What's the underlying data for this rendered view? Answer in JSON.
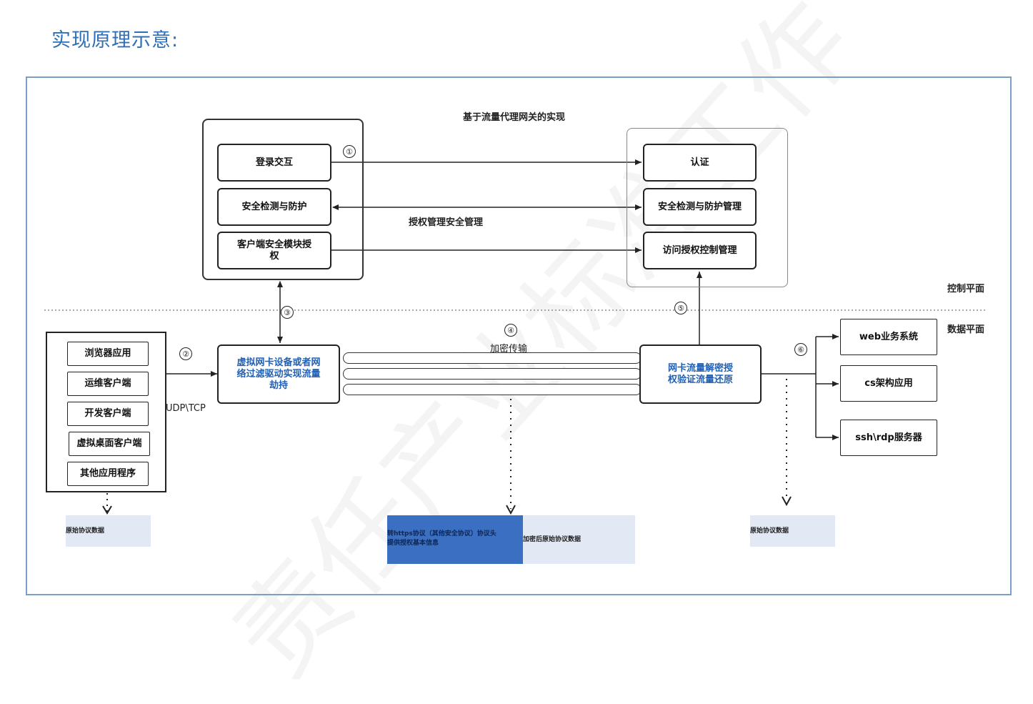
{
  "page_title": "实现原理示意:",
  "watermark": "责任产业标准工作",
  "diagram_title": "基于流量代理网关的实现",
  "client_group": {
    "login": "登录交互",
    "security_check": "安全检测与防护",
    "auth_module": "客户端安全模块授权"
  },
  "server_group": {
    "auth": "认证",
    "security_mgmt": "安全检测与防护管理",
    "access_mgmt": "访问授权控制管理"
  },
  "auth_mgmt_label": "授权管理安全管理",
  "apps": [
    "浏览器应用",
    "运维客户端",
    "开发客户端",
    "虚拟桌面客户端",
    "其他应用程序"
  ],
  "protocol_label": "UDP\\TCP",
  "virtual_nic": "虚拟网卡设备或者网络过滤驱动实现流量劫持",
  "gateway": "网卡流量解密授权验证流量还原",
  "encrypted_label": "加密传输",
  "plane_labels": {
    "control": "控制平面",
    "data": "数据平面"
  },
  "targets": [
    "web业务系统",
    "cs架构应用",
    "ssh\\rdp服务器"
  ],
  "steps": [
    "①",
    "②",
    "③",
    "④",
    "⑤",
    "⑥"
  ],
  "notes": {
    "original_left": "原始协议数据",
    "https_note": "转https协议（其他安全协议）协议头提供授权基本信息",
    "encrypted_original": "加密后原始协议数据",
    "original_right": "原始协议数据"
  }
}
